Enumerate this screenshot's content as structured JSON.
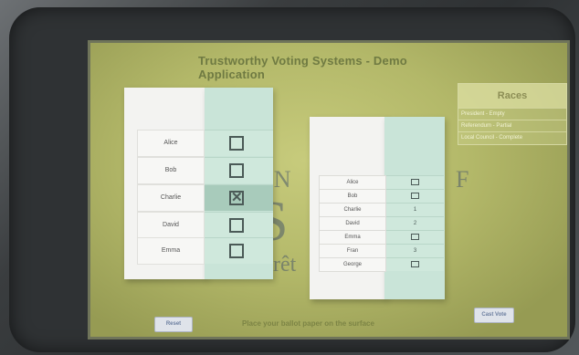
{
  "app": {
    "title": "Trustworthy Voting Systems - Demo Application"
  },
  "watermark": {
    "line1": "UN",
    "line2": "S",
    "line3": "F",
    "line4": "rêt"
  },
  "races": {
    "title": "Races",
    "items": [
      "President - Empty",
      "Referendum - Partial",
      "Local Council - Complete"
    ]
  },
  "ballot1": {
    "candidates": [
      {
        "name": "Alice",
        "mark": ""
      },
      {
        "name": "Bob",
        "mark": ""
      },
      {
        "name": "Charlie",
        "mark": "✕"
      },
      {
        "name": "David",
        "mark": ""
      },
      {
        "name": "Emma",
        "mark": ""
      }
    ]
  },
  "ballot2": {
    "candidates": [
      {
        "name": "Alice",
        "rank": ""
      },
      {
        "name": "Bob",
        "rank": ""
      },
      {
        "name": "Charlie",
        "rank": "1"
      },
      {
        "name": "David",
        "rank": "2"
      },
      {
        "name": "Emma",
        "rank": ""
      },
      {
        "name": "Fran",
        "rank": "3"
      },
      {
        "name": "George",
        "rank": ""
      }
    ]
  },
  "footer": {
    "reset_label": "Reset",
    "instruction": "Place your ballot paper on the surface",
    "cast_label": "Cast Vote"
  }
}
